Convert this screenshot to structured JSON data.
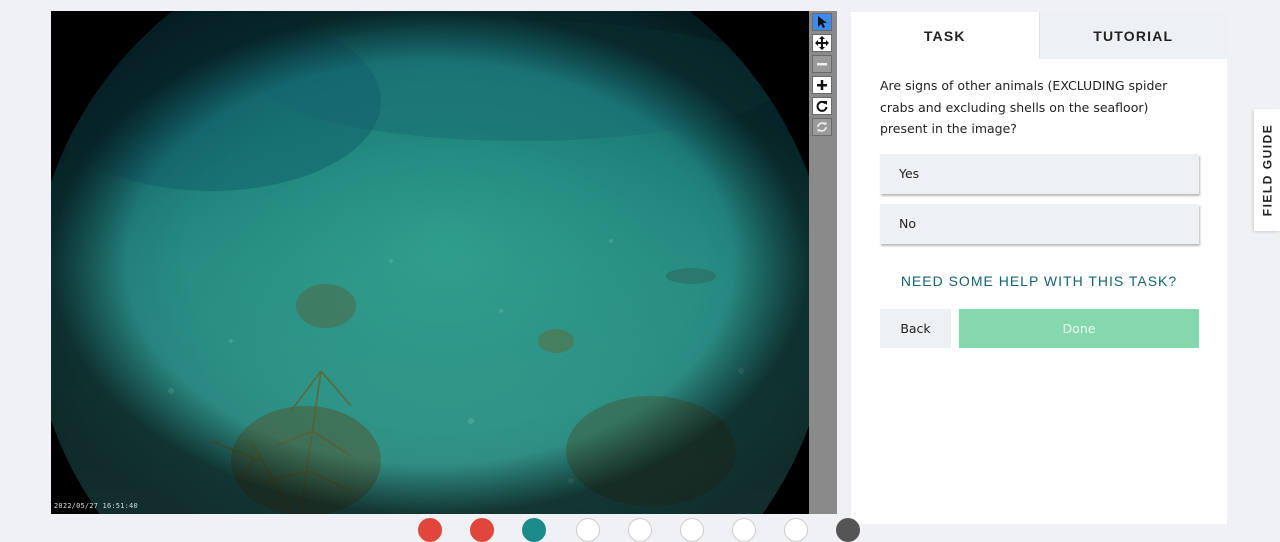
{
  "viewer": {
    "timestamp": "2022/05/27 16:51:40"
  },
  "toolbar": {
    "tools": [
      {
        "icon": "pointer-icon",
        "state": "active"
      },
      {
        "icon": "move-icon",
        "state": "normal"
      },
      {
        "icon": "zoom-out-icon",
        "state": "disabled"
      },
      {
        "icon": "zoom-in-icon",
        "state": "normal"
      },
      {
        "icon": "rotate-icon",
        "state": "normal"
      },
      {
        "icon": "reset-icon",
        "state": "disabled"
      }
    ]
  },
  "task_panel": {
    "tabs": {
      "task": "TASK",
      "tutorial": "TUTORIAL"
    },
    "question": "Are signs of other animals (EXCLUDING spider crabs and excluding shells on the seafloor) present in the image?",
    "answers": {
      "yes": "Yes",
      "no": "No"
    },
    "help_link": "NEED SOME HELP WITH THIS TASK?",
    "back_label": "Back",
    "done_label": "Done"
  },
  "field_guide_label": "FIELD GUIDE",
  "colors": {
    "page_bg": "#eff1f4",
    "accent_teal": "#14646e",
    "done_button": "#85d7ad",
    "active_tool": "#3c8cf0"
  }
}
